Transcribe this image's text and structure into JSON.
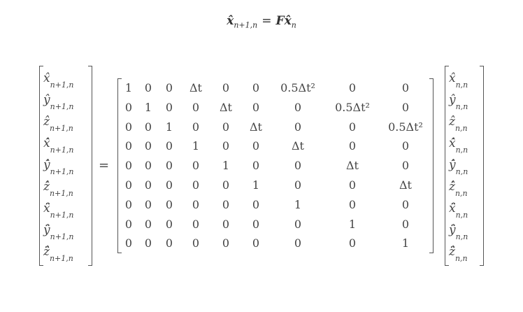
{
  "top_equation": {
    "lhs_symbol": "x̂",
    "lhs_sub": "n+1,n",
    "equals": "=",
    "matrix_symbol": "F",
    "rhs_symbol": "x̂",
    "rhs_sub": "n"
  },
  "left_vector": [
    {
      "sym": "x̂",
      "sub": "n+1,n"
    },
    {
      "sym": "ŷ",
      "sub": "n+1,n"
    },
    {
      "sym": "ẑ",
      "sub": "n+1,n"
    },
    {
      "sym": "x̂̇",
      "sub": "n+1,n"
    },
    {
      "sym": "ŷ̇",
      "sub": "n+1,n"
    },
    {
      "sym": "ẑ̇",
      "sub": "n+1,n"
    },
    {
      "sym": "x̂̈",
      "sub": "n+1,n"
    },
    {
      "sym": "ŷ̈",
      "sub": "n+1,n"
    },
    {
      "sym": "ẑ̈",
      "sub": "n+1,n"
    }
  ],
  "equals_sign": "=",
  "matrix": [
    [
      "1",
      "0",
      "0",
      "Δt",
      "0",
      "0",
      "0.5Δt²",
      "0",
      "0"
    ],
    [
      "0",
      "1",
      "0",
      "0",
      "Δt",
      "0",
      "0",
      "0.5Δt²",
      "0"
    ],
    [
      "0",
      "0",
      "1",
      "0",
      "0",
      "Δt",
      "0",
      "0",
      "0.5Δt²"
    ],
    [
      "0",
      "0",
      "0",
      "1",
      "0",
      "0",
      "Δt",
      "0",
      "0"
    ],
    [
      "0",
      "0",
      "0",
      "0",
      "1",
      "0",
      "0",
      "Δt",
      "0"
    ],
    [
      "0",
      "0",
      "0",
      "0",
      "0",
      "1",
      "0",
      "0",
      "Δt"
    ],
    [
      "0",
      "0",
      "0",
      "0",
      "0",
      "0",
      "1",
      "0",
      "0"
    ],
    [
      "0",
      "0",
      "0",
      "0",
      "0",
      "0",
      "0",
      "1",
      "0"
    ],
    [
      "0",
      "0",
      "0",
      "0",
      "0",
      "0",
      "0",
      "0",
      "1"
    ]
  ],
  "right_vector": [
    {
      "sym": "x̂",
      "sub": "n,n"
    },
    {
      "sym": "ŷ",
      "sub": "n,n"
    },
    {
      "sym": "ẑ",
      "sub": "n,n"
    },
    {
      "sym": "x̂̇",
      "sub": "n,n"
    },
    {
      "sym": "ŷ̇",
      "sub": "n,n"
    },
    {
      "sym": "ẑ̇",
      "sub": "n,n"
    },
    {
      "sym": "x̂̈",
      "sub": "n,n"
    },
    {
      "sym": "ŷ̈",
      "sub": "n,n"
    },
    {
      "sym": "ẑ̈",
      "sub": "n,n"
    }
  ]
}
